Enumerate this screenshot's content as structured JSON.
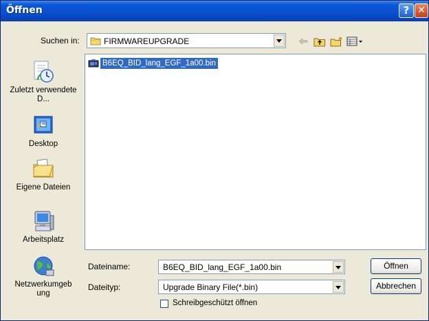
{
  "window": {
    "title": "Öffnen"
  },
  "titlebar": {
    "help_glyph": "?",
    "close_glyph": "✕"
  },
  "location": {
    "label": "Suchen in:",
    "value": "FIRMWAREUPGRADE"
  },
  "toolbar": {
    "icons": [
      "back-arrow-icon",
      "up-folder-icon",
      "new-folder-icon",
      "view-menu-icon"
    ]
  },
  "places": [
    {
      "label": "Zuletzt verwendete D...",
      "icon": "recent-documents-icon"
    },
    {
      "label": "Desktop",
      "icon": "desktop-icon"
    },
    {
      "label": "Eigene Dateien",
      "icon": "my-documents-icon"
    },
    {
      "label": "Arbeitsplatz",
      "icon": "my-computer-icon"
    },
    {
      "label": "Netzwerkumgebung",
      "icon": "network-places-icon"
    }
  ],
  "files": [
    {
      "name": "B6EQ_BID_lang_EGF_1a00.bin",
      "selected": true
    }
  ],
  "filename": {
    "label": "Dateiname:",
    "value": "B6EQ_BID_lang_EGF_1a00.bin"
  },
  "filetype": {
    "label": "Dateityp:",
    "value": "Upgrade Binary File(*.bin)"
  },
  "readonly": {
    "label": "Schreibgeschützt öffnen",
    "checked": false
  },
  "buttons": {
    "open": "Öffnen",
    "cancel": "Abbrechen"
  },
  "colors": {
    "titlebar": "#0a4fd1",
    "selection": "#316ac5",
    "dialog_bg": "#ece9d8",
    "border": "#7f9db9"
  }
}
